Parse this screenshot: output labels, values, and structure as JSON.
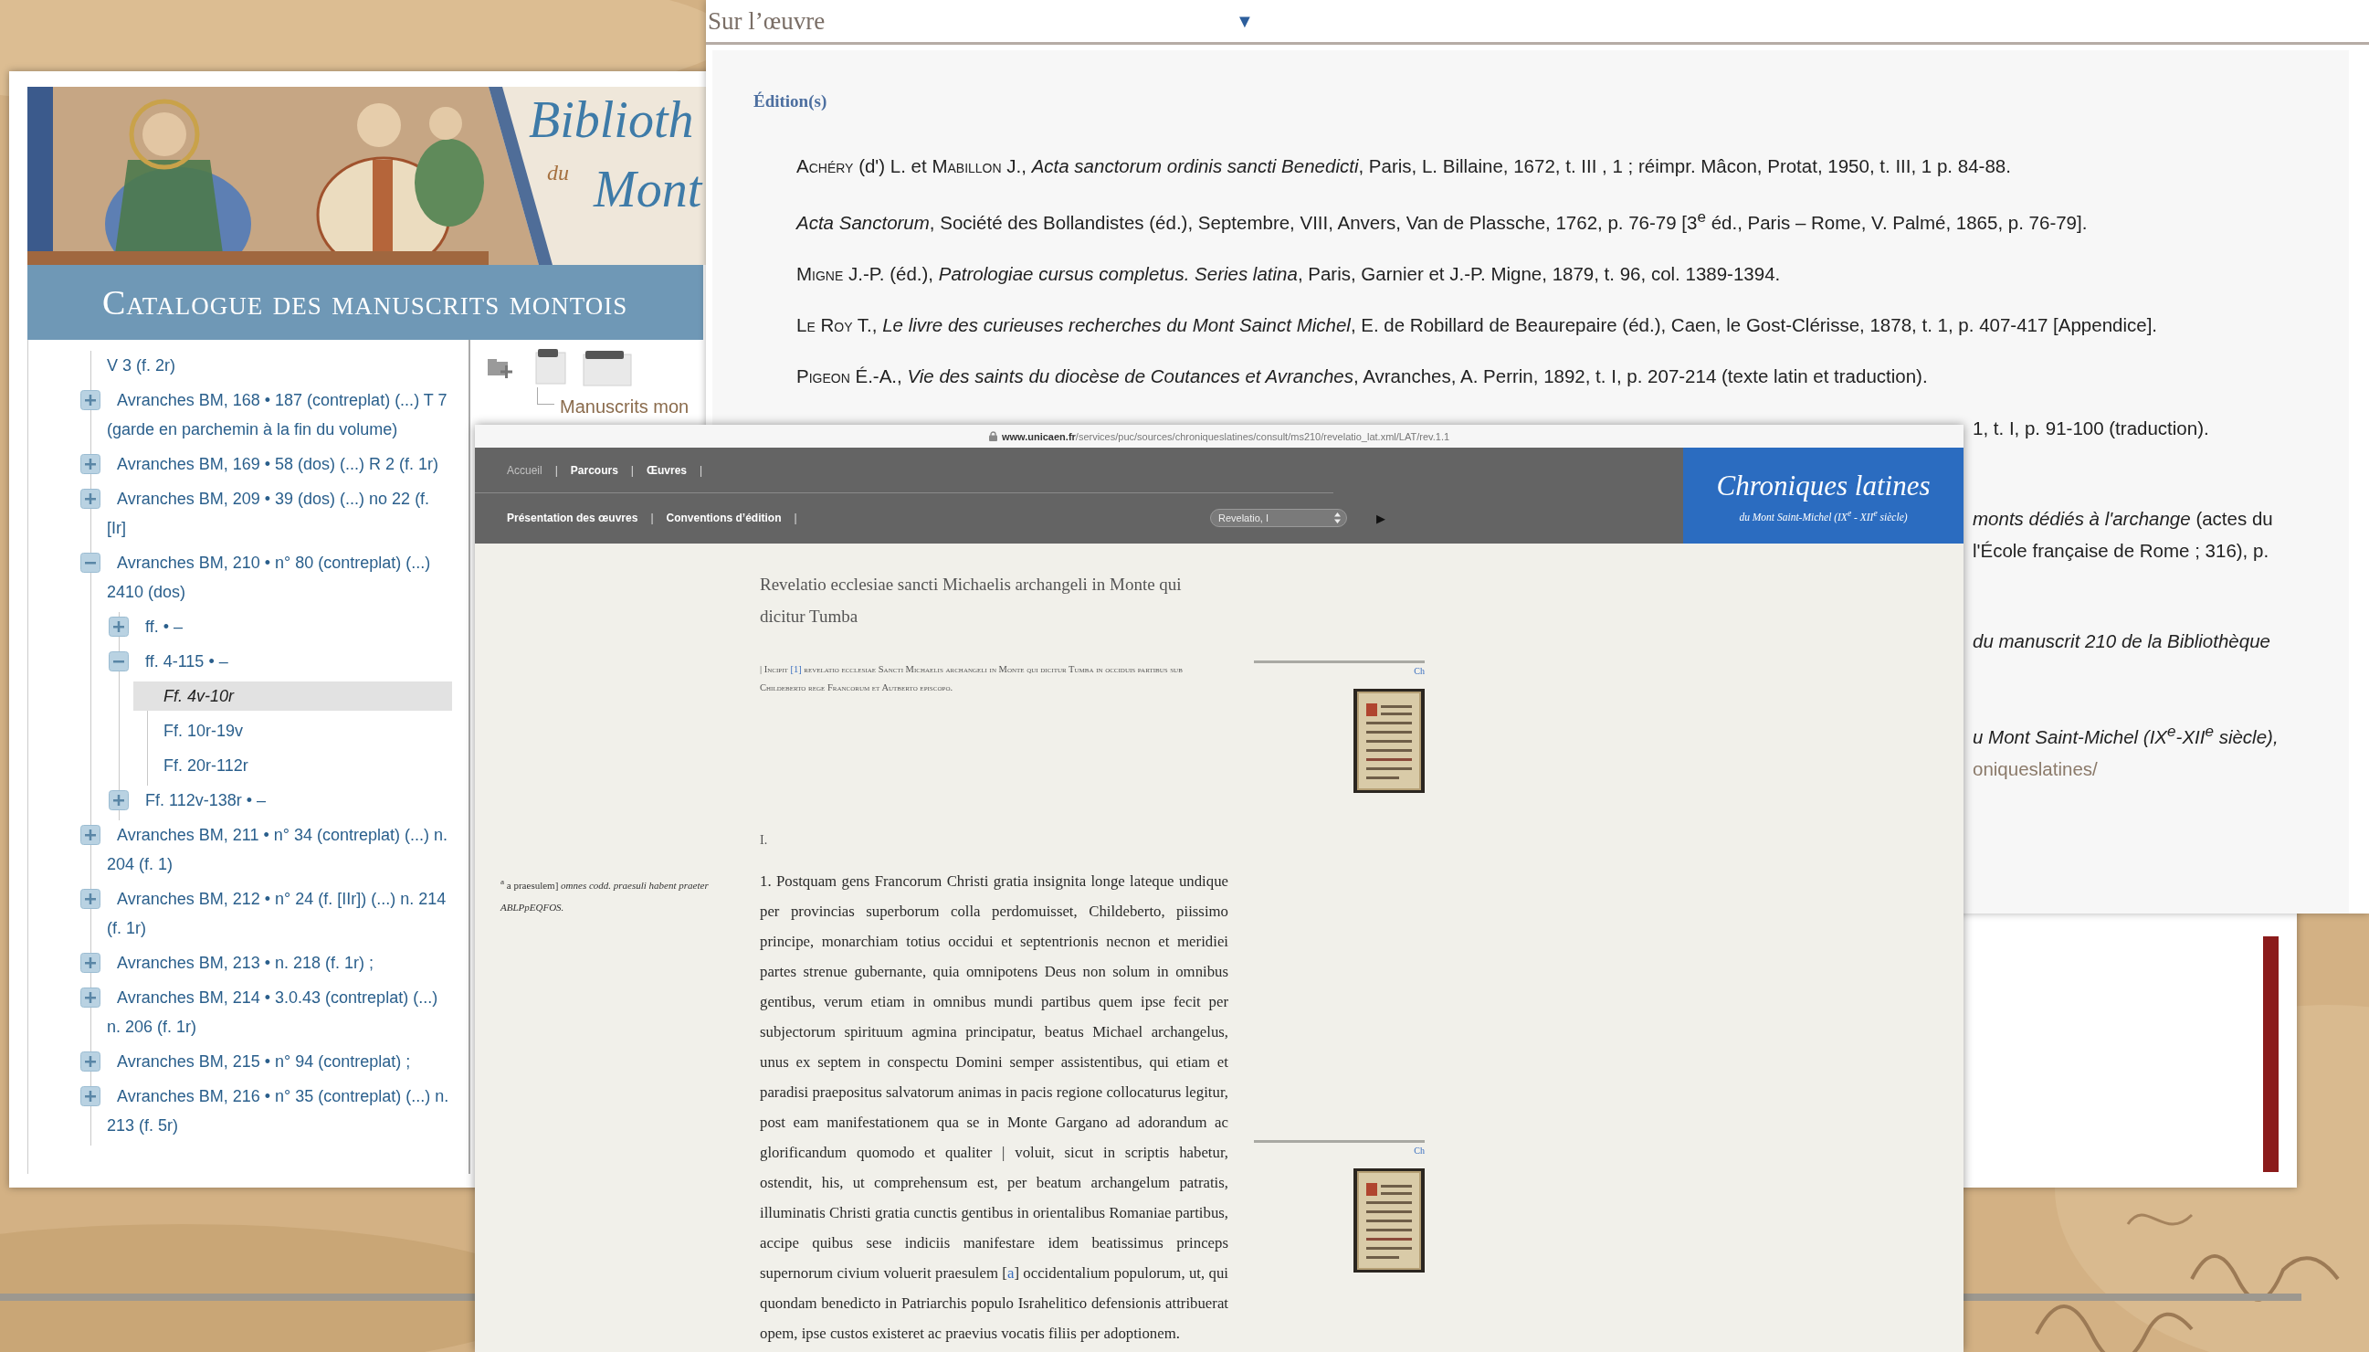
{
  "catalogue": {
    "title_line1": "Biblioth",
    "title_small": "du",
    "title_line2": "Mont",
    "banner": "Catalogue des manuscrits montois",
    "tree": [
      {
        "label": "V 3 (f. 2r)",
        "selected": false
      },
      {
        "label": "Avranches BM, 168 • 187 (contreplat) (...) T 7 (garde en parchemin à la fin du volume)",
        "expanded": false,
        "selected": false
      },
      {
        "label": "Avranches BM, 169 • 58 (dos) (...) R 2 (f. 1r)",
        "expanded": false,
        "selected": false
      },
      {
        "label": "Avranches BM, 209 • 39 (dos) (...) no 22 (f. [Ir]",
        "expanded": false,
        "selected": false
      },
      {
        "label": "Avranches BM, 210 • n° 80 (contreplat) (...) 2410 (dos)",
        "expanded": true,
        "selected": false,
        "children": [
          {
            "label": "ff. • –",
            "expanded": false,
            "selected": false
          },
          {
            "label": "ff. 4-115 • –",
            "expanded": true,
            "selected": false,
            "children": [
              {
                "label": "Ff. 4v-10r",
                "selected": true
              },
              {
                "label": "Ff. 10r-19v",
                "selected": false
              },
              {
                "label": "Ff. 20r-112r",
                "selected": false
              }
            ]
          },
          {
            "label": "Ff. 112v-138r • –",
            "expanded": false,
            "selected": false
          }
        ]
      },
      {
        "label": "Avranches BM, 211 • n° 34 (contreplat) (...) n. 204 (f. 1)",
        "expanded": false,
        "selected": false
      },
      {
        "label": "Avranches BM, 212 • n° 24 (f. [IIr]) (...) n. 214 (f. 1r)",
        "expanded": false,
        "selected": false
      },
      {
        "label": "Avranches BM, 213 • n. 218 (f. 1r) ;",
        "expanded": false,
        "selected": false
      },
      {
        "label": "Avranches BM, 214 • 3.0.43 (contreplat) (...) n. 206 (f. 1r)",
        "expanded": false,
        "selected": false
      },
      {
        "label": "Avranches BM, 215 • n° 94 (contreplat) ;",
        "expanded": false,
        "selected": false
      },
      {
        "label": "Avranches BM, 216 • n° 35 (contreplat) (...) n. 213 (f. 5r)",
        "expanded": false,
        "selected": false
      }
    ],
    "breadcrumb": "Manuscrits mon"
  },
  "work": {
    "header": "Sur l’œuvre",
    "toggle": "▼",
    "section": "Édition(s)",
    "entries": [
      {
        "parts": [
          {
            "kind": "smallcaps",
            "text": "Achéry"
          },
          {
            "kind": "text",
            "text": " (d') L. et "
          },
          {
            "kind": "smallcaps",
            "text": "Mabillon"
          },
          {
            "kind": "text",
            "text": " J., *Acta sanctorum ordinis sancti Benedicti*, Paris, L. Billaine, 1672, t. III , 1 ; réimpr. Mâcon, Protat, 1950, t. III, 1 p. 84-88."
          }
        ]
      },
      {
        "parts": [
          {
            "kind": "text",
            "text": "*Acta Sanctorum*, Société des Bollandistes (éd.), Septembre, VIII, Anvers, Van de Plassche, 1762, p. 76-79 [3$^{e}$ éd., Paris – Rome, V. Palmé, 1865, p. 76-79]."
          }
        ]
      },
      {
        "parts": [
          {
            "kind": "smallcaps",
            "text": "Migne"
          },
          {
            "kind": "text",
            "text": " J.-P. (éd.), *Patrologiae cursus completus. Series latina*, Paris, Garnier et J.-P. Migne, 1879, t. 96, col. 1389-1394."
          }
        ]
      },
      {
        "parts": [
          {
            "kind": "smallcaps",
            "text": "Le Roy"
          },
          {
            "kind": "text",
            "text": " T., *Le livre des curieuses recherches du Mont Sainct Michel*, E. de Robillard de Beaurepaire (éd.), Caen, le Gost-Clérisse, 1878, t. 1, p. 407-417 [Appendice]."
          }
        ]
      },
      {
        "parts": [
          {
            "kind": "smallcaps",
            "text": "Pigeon"
          },
          {
            "kind": "text",
            "text": " É.-A., *Vie des saints du diocèse de Coutances et Avranches*, Avranches, A. Perrin, 1892, t. I, p. 207-214 (texte latin et traduction)."
          }
        ]
      }
    ],
    "partial_entries": [
      {
        "lines": [
          {
            "kind": "text",
            "text": "1, t. I, p. 91-100 (traduction)."
          }
        ]
      },
      {
        "lines": [
          {
            "kind": "text",
            "text": "*monts dédiés à l'archange* (actes du"
          },
          {
            "kind": "text",
            "text": "l'École française de Rome ; 316), p."
          }
        ]
      },
      {
        "lines": [
          {
            "kind": "italic",
            "text": "du manuscrit 210 de la Bibliothèque"
          }
        ]
      },
      {
        "lines": [
          {
            "kind": "italic",
            "text": "u Mont Saint-Michel (IX$^{e}$-XII$^{e}$ siècle),"
          },
          {
            "kind": "link",
            "text": "oniqueslatines/"
          }
        ]
      }
    ]
  },
  "edition": {
    "url_host": "www.unicaen.fr",
    "url_path": "/services/puc/sources/chroniqueslatines/consult/ms210/revelatio_lat.xml/LAT/rev.1.1",
    "nav_rows": [
      [
        {
          "kind": "link",
          "label": "Accueil",
          "muted": true
        },
        {
          "kind": "separator",
          "label": "|"
        },
        {
          "kind": "link",
          "label": "Parcours",
          "muted": false
        },
        {
          "kind": "separator",
          "label": "|"
        },
        {
          "kind": "link",
          "label": "Œuvres",
          "muted": false
        },
        {
          "kind": "separator",
          "label": "|"
        }
      ],
      [
        {
          "kind": "link",
          "label": "Présentation des œuvres",
          "muted": false
        },
        {
          "kind": "separator",
          "label": "|"
        },
        {
          "kind": "link",
          "label": "Conventions d’édition",
          "muted": false
        },
        {
          "kind": "separator",
          "label": "|"
        }
      ]
    ],
    "select": "Revelatio, I",
    "next": "▶",
    "brand_title": "Chroniques latines",
    "brand_subtitle": "du Mont Saint-Michel (IX$^{e}$ - XII$^{e}$ siècle)",
    "title": "Revelatio ecclesiae sancti Michaelis archangeli in Monte qui dicitur Tumba",
    "incipit": [
      {
        "kind": "text",
        "text": "| Incipit "
      },
      {
        "kind": "link",
        "text": "[1]"
      },
      {
        "kind": "text",
        "text": " revelatio ecclesiae Sancti Michaelis archangeli in Monte qui dicitur Tumba in occiduis partibus sub Childeberto rege Francorum et Autberto episcopo."
      }
    ],
    "section": "I.",
    "note": "$^{a}$ a praesulem] *omnes codd. praesuli habent praeter ABLPpEQFOS.*",
    "paragraph": [
      {
        "kind": "text",
        "text": "1. Postquam gens Francorum Christi gratia insignita longe lateque undique per provincias superborum colla perdomuisset, Childeberto, piissimo principe, monarchiam totius occidui et septentrionis necnon et meridiei partes strenue gubernante, quia omnipotens Deus non solum in omnibus gentibus, verum etiam in omnibus mundi partibus quem ipse fecit per subjectorum spirituum agmina principatur, beatus Michael archangelus, unus ex septem in conspectu Domini semper assistentibus, qui etiam et paradisi praepositus salvatorum animas in pacis regione collocaturus legitur, post eam manifestationem qua se in Monte Gargano ad adorandum ac glorificandum quomodo et qualiter | voluit, sicut in scriptis habetur, ostendit, his, ut comprehensum est, per beatum archangelum patratis, illuminatis Christi gratia cunctis gentibus in orientalibus Romaniae partibus, accipe quibus sese indiciis manifestare idem beatissimus princeps supernorum civium voluerit praesulem ["
      },
      {
        "kind": "link",
        "text": "a"
      },
      {
        "kind": "text",
        "text": "] occidentalium populorum, ut, qui quondam benedicto in Patriarchis populo Israhelitico defensionis attribuerat opem, ipse custos existeret ac praevius vocatis filiis per adoptionem."
      }
    ],
    "figures": [
      {
        "label": "Ch"
      },
      {
        "label": "Ch"
      }
    ]
  }
}
